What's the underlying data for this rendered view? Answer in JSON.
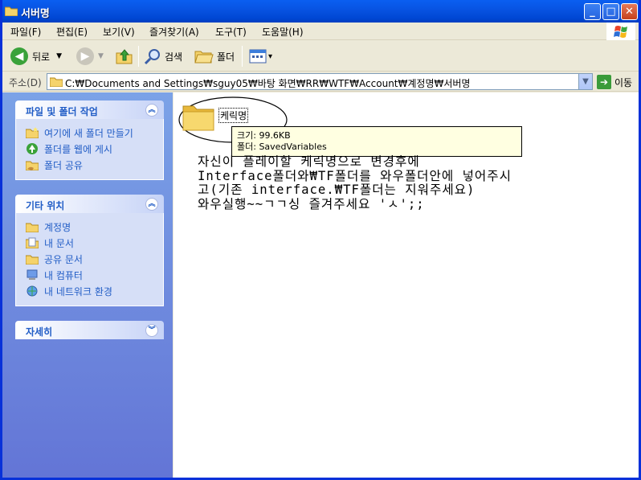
{
  "window": {
    "title": "서버명"
  },
  "title_buttons": {
    "minimize": "_",
    "maximize": "□",
    "close": "✕"
  },
  "menu": [
    {
      "label": "파일(F)"
    },
    {
      "label": "편집(E)"
    },
    {
      "label": "보기(V)"
    },
    {
      "label": "즐겨찾기(A)"
    },
    {
      "label": "도구(T)"
    },
    {
      "label": "도움말(H)"
    }
  ],
  "toolbar": {
    "back_label": "뒤로",
    "search_label": "검색",
    "folders_label": "폴더",
    "dropdown_glyph": "▾"
  },
  "address": {
    "label": "주소(D)",
    "path": "C:₩Documents and Settings₩sguy05₩바탕 화면₩RR₩WTF₩Account₩계정명₩서버명",
    "go_label": "이동"
  },
  "sidebar": {
    "panels": [
      {
        "title": "파일 및 폴더 작업",
        "toggle": "︽",
        "items": [
          {
            "label": "여기에 새 폴더 만들기",
            "icon": "new-folder-icon"
          },
          {
            "label": "폴더를 웹에 게시",
            "icon": "publish-web-icon"
          },
          {
            "label": "폴더 공유",
            "icon": "share-folder-icon"
          }
        ]
      },
      {
        "title": "기타 위치",
        "toggle": "︽",
        "items": [
          {
            "label": "계정명",
            "icon": "folder-icon"
          },
          {
            "label": "내 문서",
            "icon": "my-documents-icon"
          },
          {
            "label": "공유 문서",
            "icon": "folder-icon"
          },
          {
            "label": "내 컴퓨터",
            "icon": "my-computer-icon"
          },
          {
            "label": "내 네트워크 환경",
            "icon": "network-icon"
          }
        ]
      },
      {
        "title": "자세히",
        "toggle": "︾",
        "items": []
      }
    ]
  },
  "content": {
    "folder_name": "케릭명",
    "tooltip_size": "크기: 99.6KB",
    "tooltip_folder": "폴더: SavedVariables",
    "note_lines": [
      "자신이 플레이할 케릭명으로 변경후에",
      "Interface폴더와₩TF폴더를 와우폴더안에 넣어주시",
      "고(기존 interface.₩TF폴더는 지워주세요)",
      "와우실행~~ㄱㄱ싱 즐겨주세요 'ㅅ';;"
    ]
  },
  "colors": {
    "title_blue": "#0a5ff1",
    "task_blue": "#215dc6",
    "folder_yellow": "#f5d36b"
  }
}
